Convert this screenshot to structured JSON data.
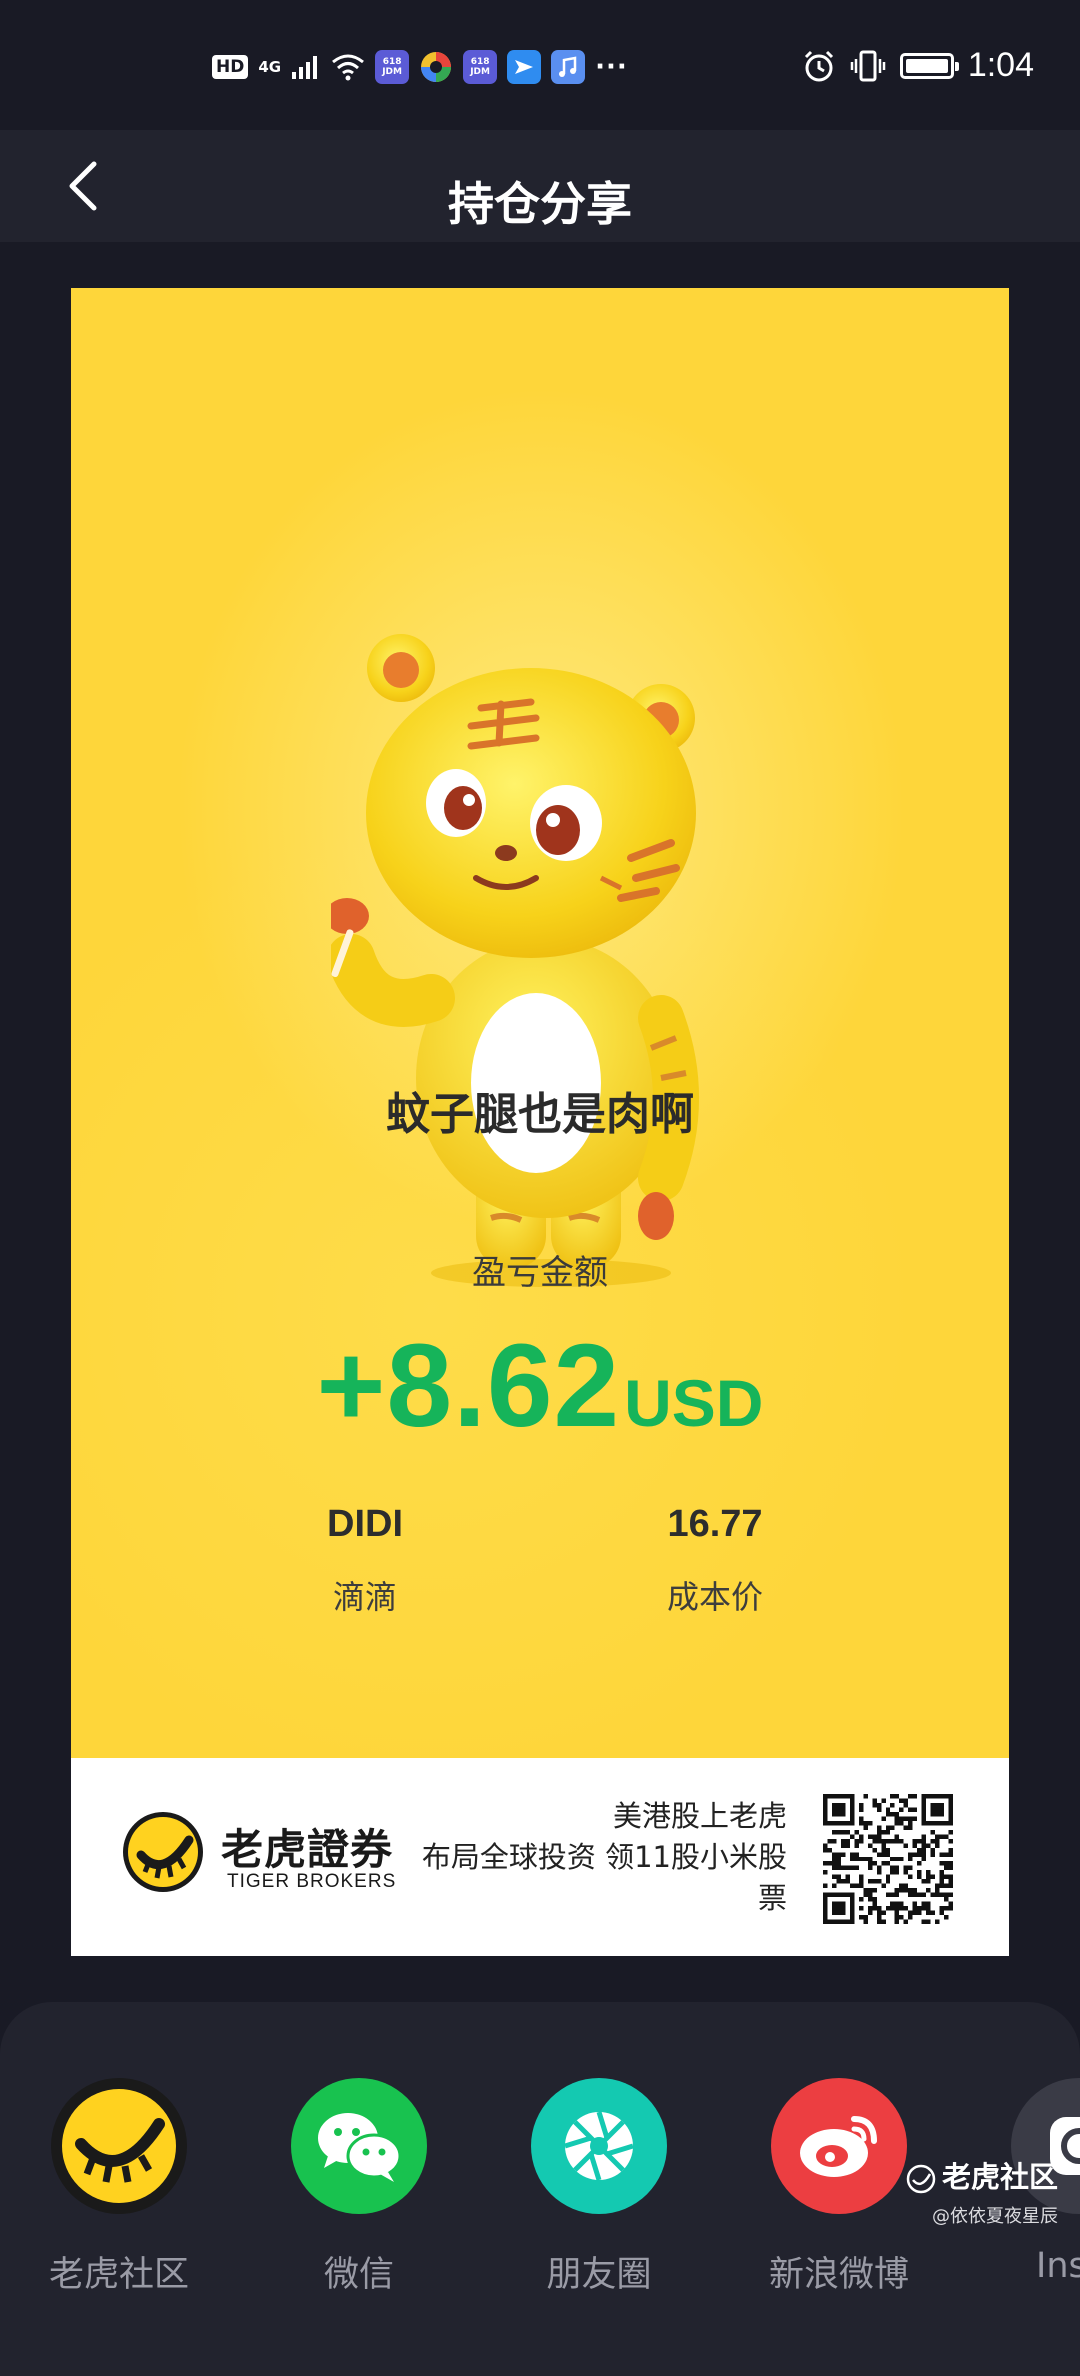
{
  "status_bar": {
    "badge": "HD",
    "network": "4G",
    "app_badges": [
      "618 JDM",
      "618 JDM"
    ],
    "more": "···",
    "time": "1:04"
  },
  "nav": {
    "title": "持仓分享",
    "back_icon": "chevron-left-icon"
  },
  "card": {
    "nickname": "蚊子腿也是肉啊",
    "pnl_label": "盈亏金额",
    "pnl_amount": "+8.62",
    "pnl_unit": "USD",
    "pnl_color": "#16b45a",
    "symbol": "DIDI",
    "symbol_name": "滴滴",
    "cost_value": "16.77",
    "cost_label": "成本价",
    "background": "#fed63a"
  },
  "footer": {
    "brand_cn": "老虎證券",
    "brand_en": "TIGER BROKERS",
    "promo_line1": "美港股上老虎",
    "promo_line2": "布局全球投资 领11股小米股",
    "promo_line3": "票"
  },
  "share": {
    "items": [
      {
        "label": "老虎社区",
        "icon": "tiger-community-icon",
        "color": "#1a1a1a"
      },
      {
        "label": "微信",
        "icon": "wechat-icon",
        "color": "#18c24f"
      },
      {
        "label": "朋友圈",
        "icon": "moments-icon",
        "color": "#14c9b1"
      },
      {
        "label": "新浪微博",
        "icon": "weibo-icon",
        "color": "#ec3e41"
      },
      {
        "label": "Insta",
        "icon": "instagram-icon",
        "color": "#3a3b46"
      }
    ]
  },
  "watermark": {
    "main": "老虎社区",
    "sub": "@依依夏夜星辰"
  }
}
